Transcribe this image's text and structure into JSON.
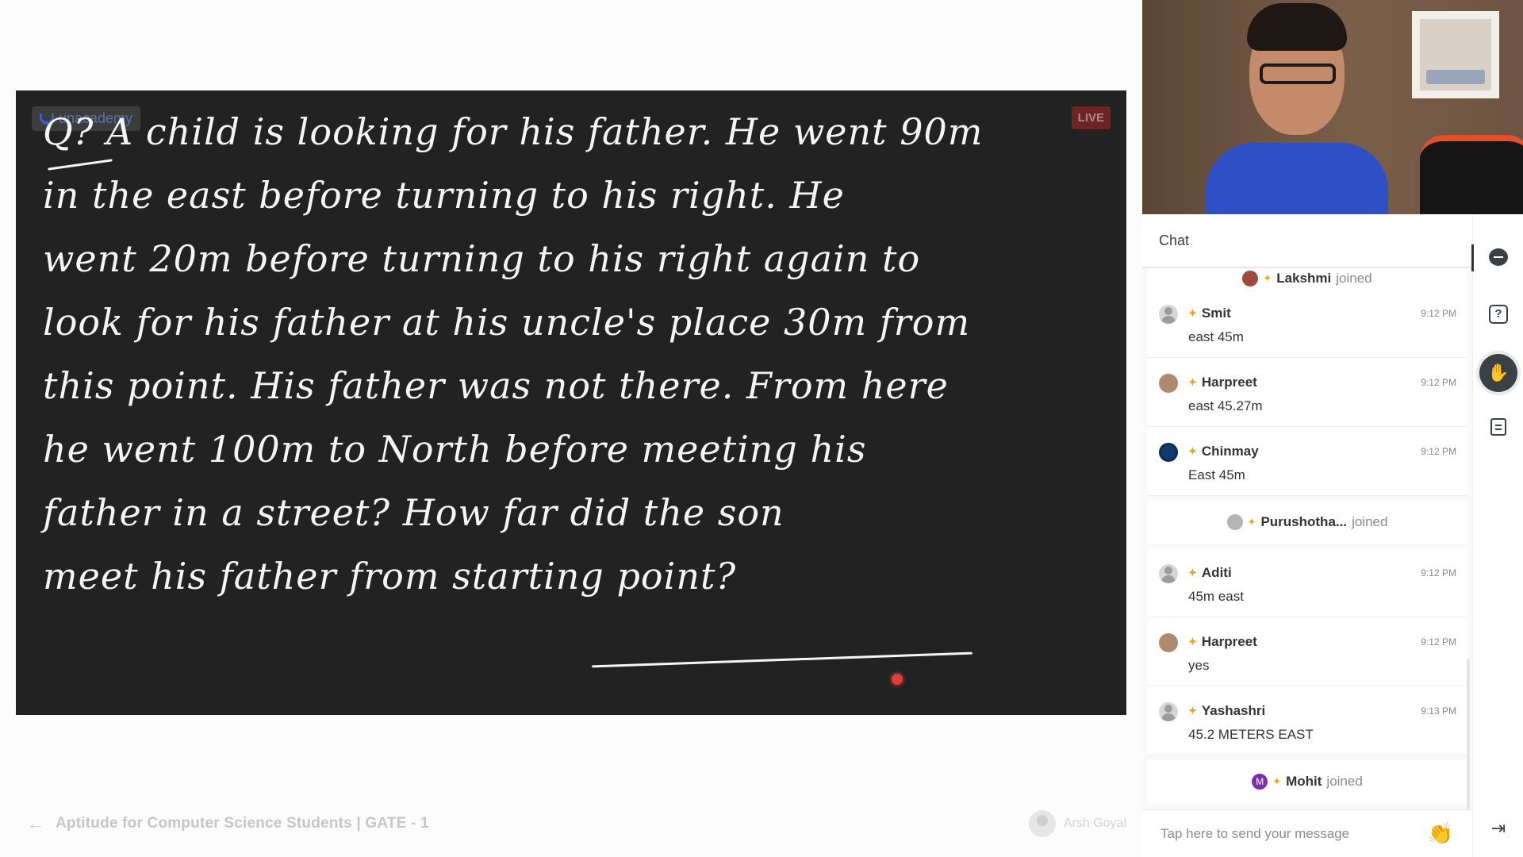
{
  "board": {
    "lines": [
      "Q? A child is looking for his father. He went 90m",
      "in the east before turning to his right. He",
      "went 20m before turning to his right again to",
      "look for his father at his uncle's place 30m from",
      "this point. His father was not there. From here",
      "he went 100m to North before meeting his",
      "father in a street? How far did the son",
      "meet his father from starting point?"
    ],
    "watermark": "unacademy",
    "live_badge": "LIVE"
  },
  "bottom": {
    "back_icon": "←",
    "course_title": "Aptitude for Computer Science Students | GATE - 1",
    "educator_name": "Arsh Goyal"
  },
  "chat": {
    "title": "Chat",
    "join_top": {
      "name": "Lakshmi",
      "suffix": "joined"
    },
    "messages_a": [
      {
        "name": "Smit",
        "time": "9:12 PM",
        "text": "east 45m",
        "avatar": "person"
      },
      {
        "name": "Harpreet",
        "time": "9:12 PM",
        "text": "east 45.27m",
        "avatar": "photo"
      },
      {
        "name": "Chinmay",
        "time": "9:12 PM",
        "text": "East 45m",
        "avatar": "dark"
      }
    ],
    "join_mid": {
      "name": "Purushotha...",
      "suffix": "joined"
    },
    "messages_b": [
      {
        "name": "Aditi",
        "time": "9:12 PM",
        "text": "45m east",
        "avatar": "person"
      },
      {
        "name": "Harpreet",
        "time": "9:12 PM",
        "text": "yes",
        "avatar": "photo"
      },
      {
        "name": "Yashashri",
        "time": "9:13 PM",
        "text": "45.2 METERS EAST",
        "avatar": "person"
      }
    ],
    "join_bottom": {
      "name": "Mohit",
      "suffix": "joined",
      "initial": "M"
    },
    "composer_placeholder": "Tap here to send your message",
    "spark_icon": "✦",
    "clap_icon": "👏"
  },
  "rail": {
    "question_glyph": "?",
    "hand_glyph": "✋",
    "exit_glyph": "⇥"
  },
  "colors": {
    "board_bg": "#222222",
    "accent_spark": "#f0a21a",
    "live_red": "#c82828"
  }
}
